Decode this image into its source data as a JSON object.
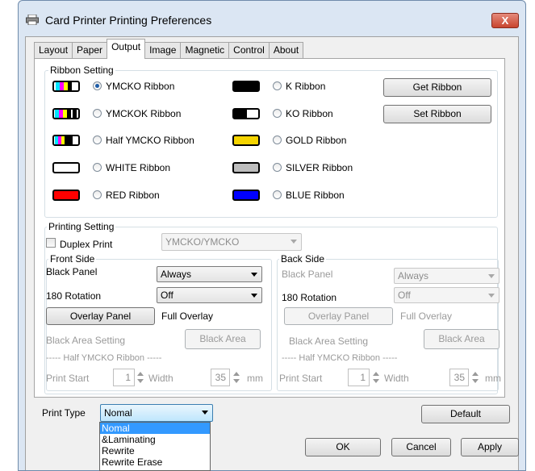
{
  "window": {
    "title": "Card Printer Printing Preferences",
    "close_label": "X"
  },
  "tabs": [
    "Layout",
    "Paper",
    "Output",
    "Image",
    "Magnetic",
    "Control",
    "About"
  ],
  "ribbon_setting": {
    "title": "Ribbon Setting",
    "left_options": [
      "YMCKO Ribbon",
      "YMCKOK Ribbon",
      "Half YMCKO Ribbon",
      "WHITE Ribbon",
      "RED Ribbon"
    ],
    "right_options": [
      "K Ribbon",
      "KO Ribbon",
      "GOLD Ribbon",
      "SILVER Ribbon",
      "BLUE Ribbon"
    ],
    "selected": "YMCKO Ribbon",
    "get_button": "Get Ribbon",
    "set_button": "Set Ribbon",
    "colors": {
      "gold": "#f5d400",
      "silver": "#bdbdbd",
      "red": "#ff0000",
      "blue": "#0000ff"
    }
  },
  "printing_setting": {
    "title": "Printing Setting",
    "duplex_label": "Duplex Print",
    "duplex_mode": "YMCKO/YMCKO",
    "front": {
      "title": "Front Side",
      "black_panel_label": "Black Panel",
      "black_panel_value": "Always",
      "rotation_label": "180 Rotation",
      "rotation_value": "Off",
      "overlay_button": "Overlay Panel",
      "overlay_value": "Full Overlay",
      "black_area_label": "Black Area Setting",
      "black_area_button": "Black Area",
      "half_ymcko_label": "----- Half YMCKO Ribbon -----",
      "print_start_label": "Print Start",
      "print_start_value": "1",
      "width_label": "Width",
      "width_value": "35",
      "unit": "mm"
    },
    "back": {
      "title": "Back Side",
      "black_panel_label": "Black Panel",
      "black_panel_value": "Always",
      "rotation_label": "180 Rotation",
      "rotation_value": "Off",
      "overlay_button": "Overlay Panel",
      "overlay_value": "Full Overlay",
      "black_area_label": "Black Area Setting",
      "black_area_button": "Black Area",
      "half_ymcko_label": "----- Half YMCKO Ribbon -----",
      "print_start_label": "Print Start",
      "print_start_value": "1",
      "width_label": "Width",
      "width_value": "35",
      "unit": "mm"
    }
  },
  "print_type": {
    "label": "Print Type",
    "value": "Nomal",
    "options": [
      "Nomal",
      "&Laminating",
      "Rewrite",
      "Rewrite Erase"
    ]
  },
  "buttons": {
    "default": "Default",
    "ok": "OK",
    "cancel": "Cancel",
    "apply": "Apply"
  }
}
